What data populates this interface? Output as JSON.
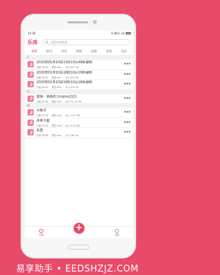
{
  "status": {
    "time": "14:36",
    "network": "0.4K/s",
    "signal": "ull"
  },
  "header": {
    "title": "乐库",
    "search_placeholder": "搜索本地歌曲"
  },
  "tabs": [
    {
      "label": "本地",
      "active": true
    },
    {
      "label": "剪切",
      "active": false
    },
    {
      "label": "合成",
      "active": false
    },
    {
      "label": "转换",
      "active": false
    },
    {
      "label": "视频",
      "active": false
    },
    {
      "label": "其他",
      "active": false
    },
    {
      "label": "历史",
      "active": false
    }
  ],
  "sections": [
    {
      "letter": "F",
      "items": [
        {
          "name": "2020年01月10日11时13分48秒录制",
          "duration": "长度:00:04",
          "type": "类型:wav",
          "size": "大小:821 kB"
        },
        {
          "name": "2020年01月10日16时10分16秒录制",
          "duration": "长度:00:03",
          "type": "类型:wav",
          "size": "大小:615 kB"
        },
        {
          "name": "2020年01月10日16时10分16秒录制",
          "duration": "长度:00:03",
          "type": "类型:wav",
          "size": "大小:643 kB"
        }
      ]
    },
    {
      "letter": "C",
      "items": [
        {
          "name": "音悟 - 讲真的 [mqms2](2)",
          "duration": "长度:03:58",
          "type": "类型:mp3",
          "size": "大小:42.15 MB"
        }
      ]
    },
    {
      "letter": "D",
      "items": [
        {
          "name": "大珠子",
          "duration": "长度:03:58",
          "type": "类型:mp3",
          "size": "大小:3.81 MB"
        },
        {
          "name": "丹青千里",
          "duration": "长度:03:58",
          "type": "类型:mp3",
          "size": "大小:9.50 MB"
        },
        {
          "name": "东西",
          "duration": "长度:00:06",
          "type": "类型:wav",
          "size": "大小:385 kB"
        }
      ]
    }
  ],
  "bottom_nav": {
    "left_label": "乐库",
    "center_label": "+",
    "right_label": "设置"
  },
  "watermark": "易享助手 • EEDSHZJZ.COM",
  "colors": {
    "accent": "#e84a6a",
    "note_icon": "#ee7b92"
  }
}
